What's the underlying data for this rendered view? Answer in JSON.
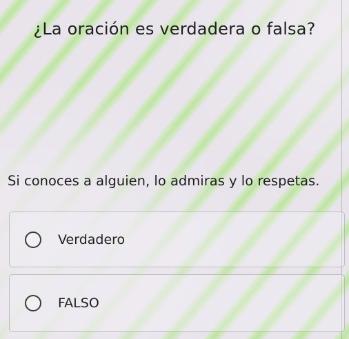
{
  "quiz": {
    "question": "¿La oración es verdadera o falsa?",
    "statement": "Si conoces a alguien, lo admiras y lo respetas.",
    "options": [
      {
        "label": "Verdadero",
        "selected": false
      },
      {
        "label": "FALSO",
        "selected": false
      }
    ]
  }
}
